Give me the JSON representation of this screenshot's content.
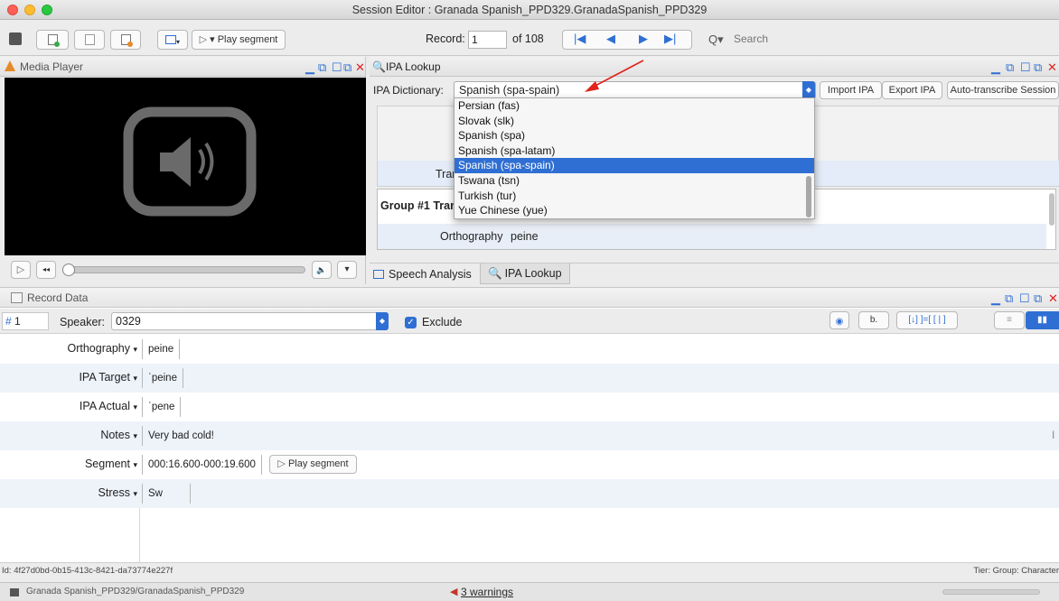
{
  "window": {
    "title": "Session Editor : Granada Spanish_PPD329.GranadaSpanish_PPD329"
  },
  "toolbar": {
    "play_segment_label": "▾ Play segment",
    "record_label": "Record:",
    "record_value": "1",
    "of_label": "of 108",
    "search_placeholder": "Search"
  },
  "media_player": {
    "title": "Media Player"
  },
  "ipa_lookup": {
    "title": "IPA Lookup",
    "dict_label": "IPA Dictionary:",
    "dict_value": "Spanish (spa-spain)",
    "import_label": "Import IPA",
    "export_label": "Export IPA",
    "auto_label": "Auto-transcribe Session",
    "options": [
      "Persian (fas)",
      "Slovak (slk)",
      "Spanish (spa)",
      "Spanish (spa-latam)",
      "Spanish (spa-spain)",
      "Tswana (tsn)",
      "Turkish (tur)",
      "Yue Chinese (yue)"
    ],
    "tran_label": "Tran",
    "group_label": "Group #1 Tran",
    "ortho_label": "Orthography",
    "ortho_value": "peine",
    "tab_speech": "Speech Analysis",
    "tab_ipa": "IPA Lookup"
  },
  "record_data": {
    "title": "Record Data",
    "record_num": "1",
    "speaker_label": "Speaker:",
    "speaker_value": "0329",
    "exclude_label": "Exclude",
    "fields": [
      {
        "label": "Orthography",
        "value": "peine"
      },
      {
        "label": "IPA Target",
        "value": "ˈpeine"
      },
      {
        "label": "IPA Actual",
        "value": "ˈpene"
      },
      {
        "label": "Notes",
        "value": "Very bad cold!"
      },
      {
        "label": "Segment",
        "value": "000:16.600-000:19.600"
      },
      {
        "label": "Stress",
        "value": "Sw"
      }
    ],
    "play_segment_btn": "Play segment",
    "id_text": "Id: 4f27d0bd-0b15-413c-8421-da73774e227f",
    "tier_text": "Tier: Group: Character"
  },
  "status": {
    "path": "Granada Spanish_PPD329/GranadaSpanish_PPD329",
    "warnings": "3 warnings"
  },
  "colors": {
    "accent": "#2f6fd3",
    "arrow": "#e0231b",
    "warning": "#c0392b"
  }
}
